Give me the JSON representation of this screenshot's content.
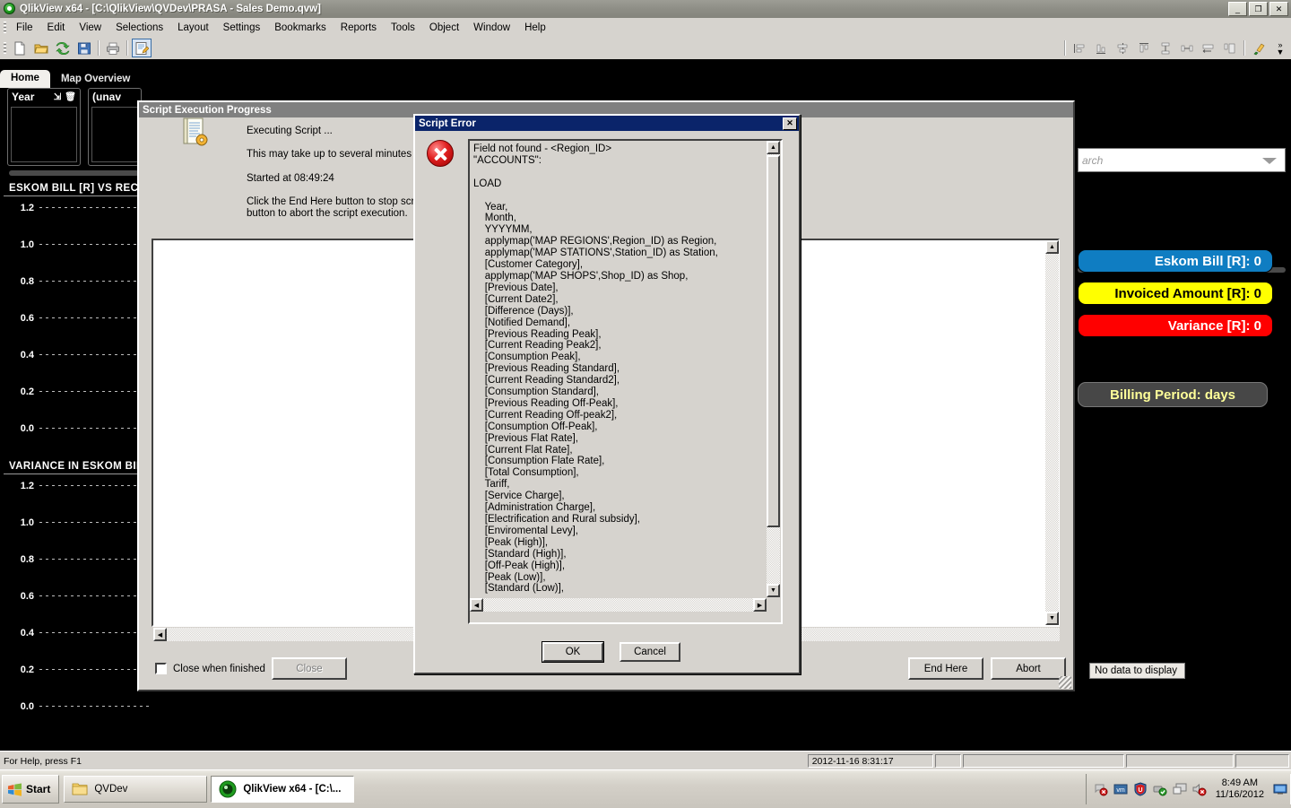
{
  "window": {
    "title": "QlikView x64 - [C:\\QlikView\\QVDev\\PRASA - Sales Demo.qvw]",
    "minimize": "_",
    "maximize": "❐",
    "close": "✕",
    "mdi_minimize": "_",
    "mdi_restore": "❐",
    "mdi_close": "✕"
  },
  "menu": [
    {
      "label": "File"
    },
    {
      "label": "Edit"
    },
    {
      "label": "View"
    },
    {
      "label": "Selections"
    },
    {
      "label": "Layout"
    },
    {
      "label": "Settings"
    },
    {
      "label": "Bookmarks"
    },
    {
      "label": "Reports"
    },
    {
      "label": "Tools"
    },
    {
      "label": "Object"
    },
    {
      "label": "Window"
    },
    {
      "label": "Help"
    }
  ],
  "toolbar": {
    "left_icons": [
      "new-document-icon",
      "open-document-icon",
      "reload-icon",
      "save-icon",
      "print-icon",
      "edit-script-icon"
    ],
    "right_icons": [
      "align-left-icon",
      "align-bottom-icon",
      "align-center-icon",
      "align-top-icon",
      "distribute-v-icon",
      "distribute-h-icon",
      "size-width-icon",
      "size-height-icon",
      "clear-selections-icon"
    ],
    "overflow": "»"
  },
  "sheet_tabs": [
    {
      "label": "Home",
      "active": true
    },
    {
      "label": "Map Overview",
      "active": false
    }
  ],
  "listboxes": [
    {
      "title": "Year",
      "tools": [
        "multi-select-icon",
        "clear-icon"
      ]
    },
    {
      "title": "(unav"
    }
  ],
  "charts": [
    {
      "title": "ESKOM BILL [R] VS RECOV",
      "ticks": [
        "1.2",
        "1.0",
        "0.8",
        "0.6",
        "0.4",
        "0.2",
        "0.0"
      ]
    },
    {
      "title": "VARIANCE IN ESKOM BILL",
      "ticks": [
        "1.2",
        "1.0",
        "0.8",
        "0.6",
        "0.4",
        "0.2",
        "0.0"
      ]
    }
  ],
  "chart_data": [
    {
      "type": "bar",
      "title": "ESKOM BILL [R] VS RECOV",
      "categories": [],
      "values": [],
      "ylim": [
        0.0,
        1.2
      ],
      "yticks": [
        0.0,
        0.2,
        0.4,
        0.6,
        0.8,
        1.0,
        1.2
      ],
      "ytick_labels": [
        "0.0",
        "0.2",
        "0.4",
        "0.6",
        "0.8",
        "1.0",
        "1.2"
      ],
      "xlabel": "",
      "ylabel": "",
      "grid": true,
      "legend": "none",
      "note": "empty plot - no data loaded; only dashed gridlines and y-axis tick labels visible"
    },
    {
      "type": "bar",
      "title": "VARIANCE IN ESKOM BILL",
      "categories": [],
      "values": [],
      "ylim": [
        0.0,
        1.2
      ],
      "yticks": [
        0.0,
        0.2,
        0.4,
        0.6,
        0.8,
        1.0,
        1.2
      ],
      "ytick_labels": [
        "0.0",
        "0.2",
        "0.4",
        "0.6",
        "0.8",
        "1.0",
        "1.2"
      ],
      "xlabel": "",
      "ylabel": "",
      "grid": true,
      "legend": "none",
      "note": "empty plot - no data loaded; only dashed gridlines and y-axis tick labels visible"
    }
  ],
  "right_panel": {
    "search_placeholder": "arch",
    "dropdown_icon": "chevron-down-icon",
    "kpis": [
      {
        "label": "Eskom Bill [R]: 0",
        "bg": "#0f7dc2",
        "fg": "#ffffff"
      },
      {
        "label": "Invoiced Amount [R]: 0",
        "bg": "#ffff00",
        "fg": "#000000"
      },
      {
        "label": "Variance [R]: 0",
        "bg": "#ff0000",
        "fg": "#ffffff"
      }
    ],
    "billing_period": {
      "label": "Billing Period:  days",
      "bg": "#474747",
      "fg": "#ffff99"
    },
    "no_data": "No data to display"
  },
  "progress_dialog": {
    "title": "Script Execution Progress",
    "icon": "script-document-icon",
    "lines": [
      "Executing Script ...",
      "This may take up to several minutes dep",
      "Started at 08:49:24",
      "Click the End Here button to stop script",
      "button to abort the script execution."
    ],
    "checkbox_label": "Close when finished",
    "checkbox_checked": false,
    "close_button": "Close",
    "end_here_button": "End Here",
    "abort_button": "Abort"
  },
  "error_dialog": {
    "title": "Script Error",
    "close_glyph": "✕",
    "icon": "error-icon",
    "message": "Field not found - <Region_ID>\n\"ACCOUNTS\":\n\nLOAD\n\n    Year,\n    Month,\n    YYYYMM,\n    applymap('MAP REGIONS',Region_ID) as Region,\n    applymap('MAP STATIONS',Station_ID) as Station,\n    [Customer Category],\n    applymap('MAP SHOPS',Shop_ID) as Shop,\n    [Previous Date],\n    [Current Date2],\n    [Difference (Days)],\n    [Notified Demand],\n    [Previous Reading Peak],\n    [Current Reading Peak2],\n    [Consumption Peak],\n    [Previous Reading Standard],\n    [Current Reading Standard2],\n    [Consumption Standard],\n    [Previous Reading Off-Peak],\n    [Current Reading Off-peak2],\n    [Consumption Off-Peak],\n    [Previous Flat Rate],\n    [Current Flat Rate],\n    [Consumption Flate Rate],\n    [Total Consumption],\n    Tariff,\n    [Service Charge],\n    [Administration Charge],\n    [Electrification and Rural subsidy],\n    [Enviromental Levy],\n    [Peak (High)],\n    [Standard (High)],\n    [Off-Peak (High)],\n    [Peak (Low)],\n    [Standard (Low)],",
    "ok_button": "OK",
    "cancel_button": "Cancel"
  },
  "statusbar": {
    "help_text": "For Help, press F1",
    "timestamp": "2012-11-16 8:31:17"
  },
  "taskbar": {
    "start_label": "Start",
    "items": [
      {
        "label": "QVDev",
        "icon": "folder-icon",
        "active": false
      },
      {
        "label": "QlikView x64 - [C:\\...",
        "icon": "qlikview-icon",
        "active": true
      }
    ],
    "tray_icons": [
      "network-disconnected-icon",
      "vm-icon",
      "security-shield-icon",
      "usb-ok-icon",
      "display-icon",
      "volume-muted-icon",
      "remote-desktop-icon"
    ],
    "clock_time": "8:49 AM",
    "clock_date": "11/16/2012"
  }
}
